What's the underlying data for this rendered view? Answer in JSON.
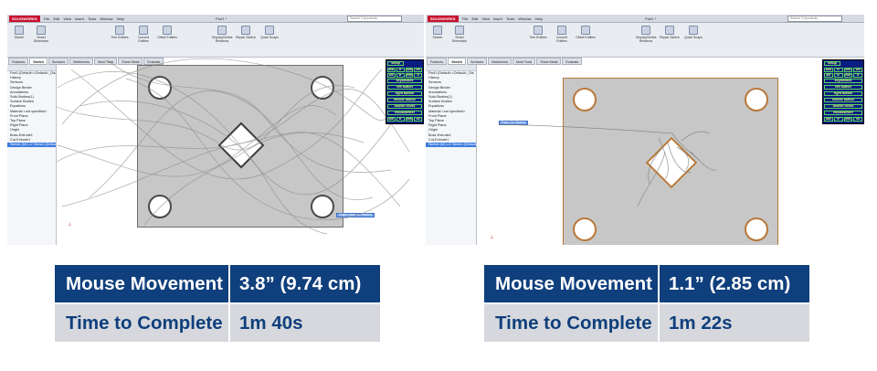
{
  "screens": [
    {
      "side": "left",
      "logo": "SOLIDWORKS",
      "menu": [
        "File",
        "Edit",
        "View",
        "Insert",
        "Tools",
        "Window",
        "Help"
      ],
      "doc_title": "Part1 *",
      "search_placeholder": "Search Commands",
      "ribbon": [
        "Sketch",
        "Smart Dimension",
        "Trim Entities",
        "Convert Entities",
        "Offset Entities",
        "Mirror Entities",
        "Linear Sketch Pattern",
        "Move Entities",
        "Display/Delete Relations",
        "Repair Sketch",
        "Quick Snaps",
        "Rapid Sketch",
        "Instant2D",
        "Shaded Sketch Contours"
      ],
      "tabs": [
        "Features",
        "Sketch",
        "Surfaces",
        "Weldments",
        "Mold Tools",
        "Sheet Metal",
        "Evaluate"
      ],
      "active_tab": 1,
      "tree": [
        "Part1 (Default<<Default>_Dis",
        "History",
        "Sensors",
        "Design Binder",
        "Annotations",
        "Solid Bodies(1)",
        "Surface Bodies",
        "Equations",
        "Material <not specified>",
        "Front Plane",
        "Top Plane",
        "Right Plane",
        "Origin",
        "Boss-Extrude1",
        "Cut-Extrude1",
        "Sketch (M) Lr2 Sketch (Default)"
      ],
      "selected_node": 15,
      "tooltip": "Origin edge <1> Sketch"
    },
    {
      "side": "right",
      "logo": "SOLIDWORKS",
      "menu": [
        "File",
        "Edit",
        "View",
        "Insert",
        "Tools",
        "Window",
        "Help"
      ],
      "doc_title": "Part1 *",
      "search_placeholder": "Search Commands",
      "ribbon": [
        "Sketch",
        "Smart Dimension",
        "Trim Entities",
        "Convert Entities",
        "Offset Entities",
        "Mirror Entities",
        "Linear Sketch Pattern",
        "Move Entities",
        "Display/Delete Relations",
        "Repair Sketch",
        "Quick Snaps",
        "Rapid Sketch",
        "Instant2D",
        "Shaded Sketch Contours"
      ],
      "tabs": [
        "Features",
        "Sketch",
        "Surfaces",
        "Weldments",
        "Mold Tools",
        "Sheet Metal",
        "Evaluate"
      ],
      "active_tab": 1,
      "tree": [
        "Part1 (Default<<Default>_Dis",
        "History",
        "Sensors",
        "Design Binder",
        "Annotations",
        "Solid Bodies(1)",
        "Surface Bodies",
        "Equations",
        "Material <not specified>",
        "Front Plane",
        "Top Plane",
        "Right Plane",
        "Origin",
        "Boss-Extrude1",
        "Cut-Extrude1",
        "Sketch (M) Lr2 Sketch (Default)"
      ],
      "selected_node": 15,
      "tooltip": "Face <1> Sketch"
    }
  ],
  "overlay": {
    "title": "setup",
    "row1": [
      "dist",
      "tr",
      "inm",
      "cm"
    ],
    "row2": [
      "km",
      "tr",
      "inm",
      "lf"
    ],
    "buttons": [
      "keystrokes",
      "left button",
      "right button",
      "middle button",
      "double clicks",
      "mousewheel"
    ],
    "row3": [
      "idle",
      "tr",
      "inm",
      "co"
    ]
  },
  "stats": [
    {
      "mouse_label": "Mouse Movement",
      "mouse_value": "3.8” (9.74 cm)",
      "time_label": "Time to Complete",
      "time_value": "1m 40s"
    },
    {
      "mouse_label": "Mouse Movement",
      "mouse_value": "1.1” (2.85 cm)",
      "time_label": "Time to Complete",
      "time_value": "1m 22s"
    }
  ],
  "colors": {
    "header_blue": "#0f3f7c",
    "row_grey": "#d6d8dd",
    "overlay_blue": "#0b1d80",
    "overlay_text": "#e8ff8a"
  }
}
